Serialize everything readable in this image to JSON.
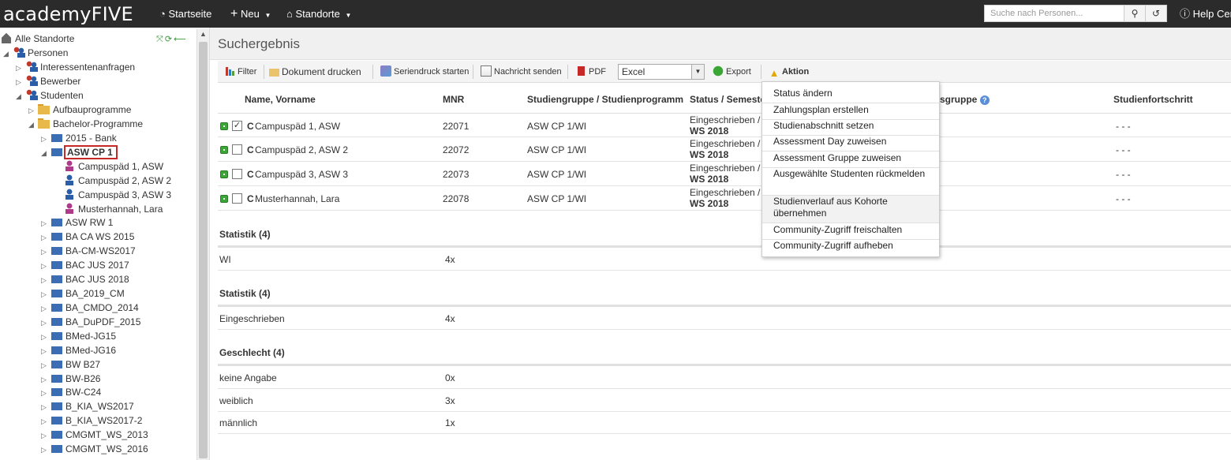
{
  "topbar": {
    "logo": "academyFIVE",
    "nav": [
      {
        "label": "Startseite",
        "icon": "dashboard-icon"
      },
      {
        "label": "Neu",
        "icon": "plus-icon"
      },
      {
        "label": "Standorte",
        "icon": "home-icon"
      }
    ],
    "search_placeholder": "Suche nach Personen...",
    "help_label": "Help Cer"
  },
  "tree": {
    "root": "Alle Standorte",
    "items": [
      "Personen",
      "Interessentenanfragen",
      "Bewerber",
      "Studenten",
      "Aufbauprogramme",
      "Bachelor-Programme",
      "2015 - Bank",
      "ASW CP 1",
      "Campuspäd 1, ASW",
      "Campuspäd 2, ASW 2",
      "Campuspäd 3, ASW 3",
      "Musterhannah, Lara",
      "ASW RW 1",
      "BA CA WS 2015",
      "BA-CM-WS2017",
      "BAC JUS 2017",
      "BAC JUS 2018",
      "BA_2019_CM",
      "BA_CMDO_2014",
      "BA_DuPDF_2015",
      "BMed-JG15",
      "BMed-JG16",
      "BW B27",
      "BW-B26",
      "BW-C24",
      "B_KIA_WS2017",
      "B_KIA_WS2017-2",
      "CMGMT_WS_2013",
      "CMGMT_WS_2016"
    ]
  },
  "main": {
    "title": "Suchergebnis",
    "toolbar": {
      "filter": "Filter",
      "print": "Dokument drucken",
      "mailmerge": "Seriendruck starten",
      "message": "Nachricht senden",
      "pdf": "PDF",
      "format_value": "Excel",
      "export": "Export",
      "action": "Aktion"
    },
    "columns": {
      "name": "Name, Vorname",
      "mnr": "MNR",
      "group": "Studiengruppe / Studienprogramm",
      "status": "Status / Semeste",
      "group2": "sgruppe",
      "progress": "Studienfortschritt"
    },
    "rows": [
      {
        "prefix": "C",
        "name": "Campuspäd 1, ASW",
        "mnr": "22071",
        "group": "ASW CP 1/WI",
        "status": "Eingeschrieben /",
        "semester": "WS 2018",
        "progress": "- - -",
        "checked": "✓"
      },
      {
        "prefix": "C",
        "name": "Campuspäd 2, ASW 2",
        "mnr": "22072",
        "group": "ASW CP 1/WI",
        "status": "Eingeschrieben /",
        "semester": "WS 2018",
        "progress": "- - -",
        "checked": ""
      },
      {
        "prefix": "C",
        "name": "Campuspäd 3, ASW 3",
        "mnr": "22073",
        "group": "ASW CP 1/WI",
        "status": "Eingeschrieben /",
        "semester": "WS 2018",
        "progress": "- - -",
        "checked": ""
      },
      {
        "prefix": "C",
        "name": "Musterhannah, Lara",
        "mnr": "22078",
        "group": "ASW CP 1/WI",
        "status": "Eingeschrieben /",
        "semester": "WS 2018",
        "progress": "- - -",
        "checked": ""
      }
    ],
    "stats": [
      {
        "heading": "Statistik (4)",
        "rows": [
          {
            "label": "WI",
            "value": "4x"
          }
        ]
      },
      {
        "heading": "Statistik (4)",
        "rows": [
          {
            "label": "Eingeschrieben",
            "value": "4x"
          }
        ]
      },
      {
        "heading": "Geschlecht (4)",
        "rows": [
          {
            "label": "keine Angabe",
            "value": "0x"
          },
          {
            "label": "weiblich",
            "value": "3x"
          },
          {
            "label": "männlich",
            "value": "1x"
          }
        ]
      }
    ]
  },
  "action_menu": [
    "Status ändern",
    "Zahlungsplan erstellen",
    "Studienabschnitt setzen",
    "Assessment Day zuweisen",
    "Assessment Gruppe zuweisen",
    "Ausgewählte Studenten rückmelden",
    "Studienverlauf aus Kohorte übernehmen",
    "Community-Zugriff freischalten",
    "Community-Zugriff aufheben"
  ]
}
